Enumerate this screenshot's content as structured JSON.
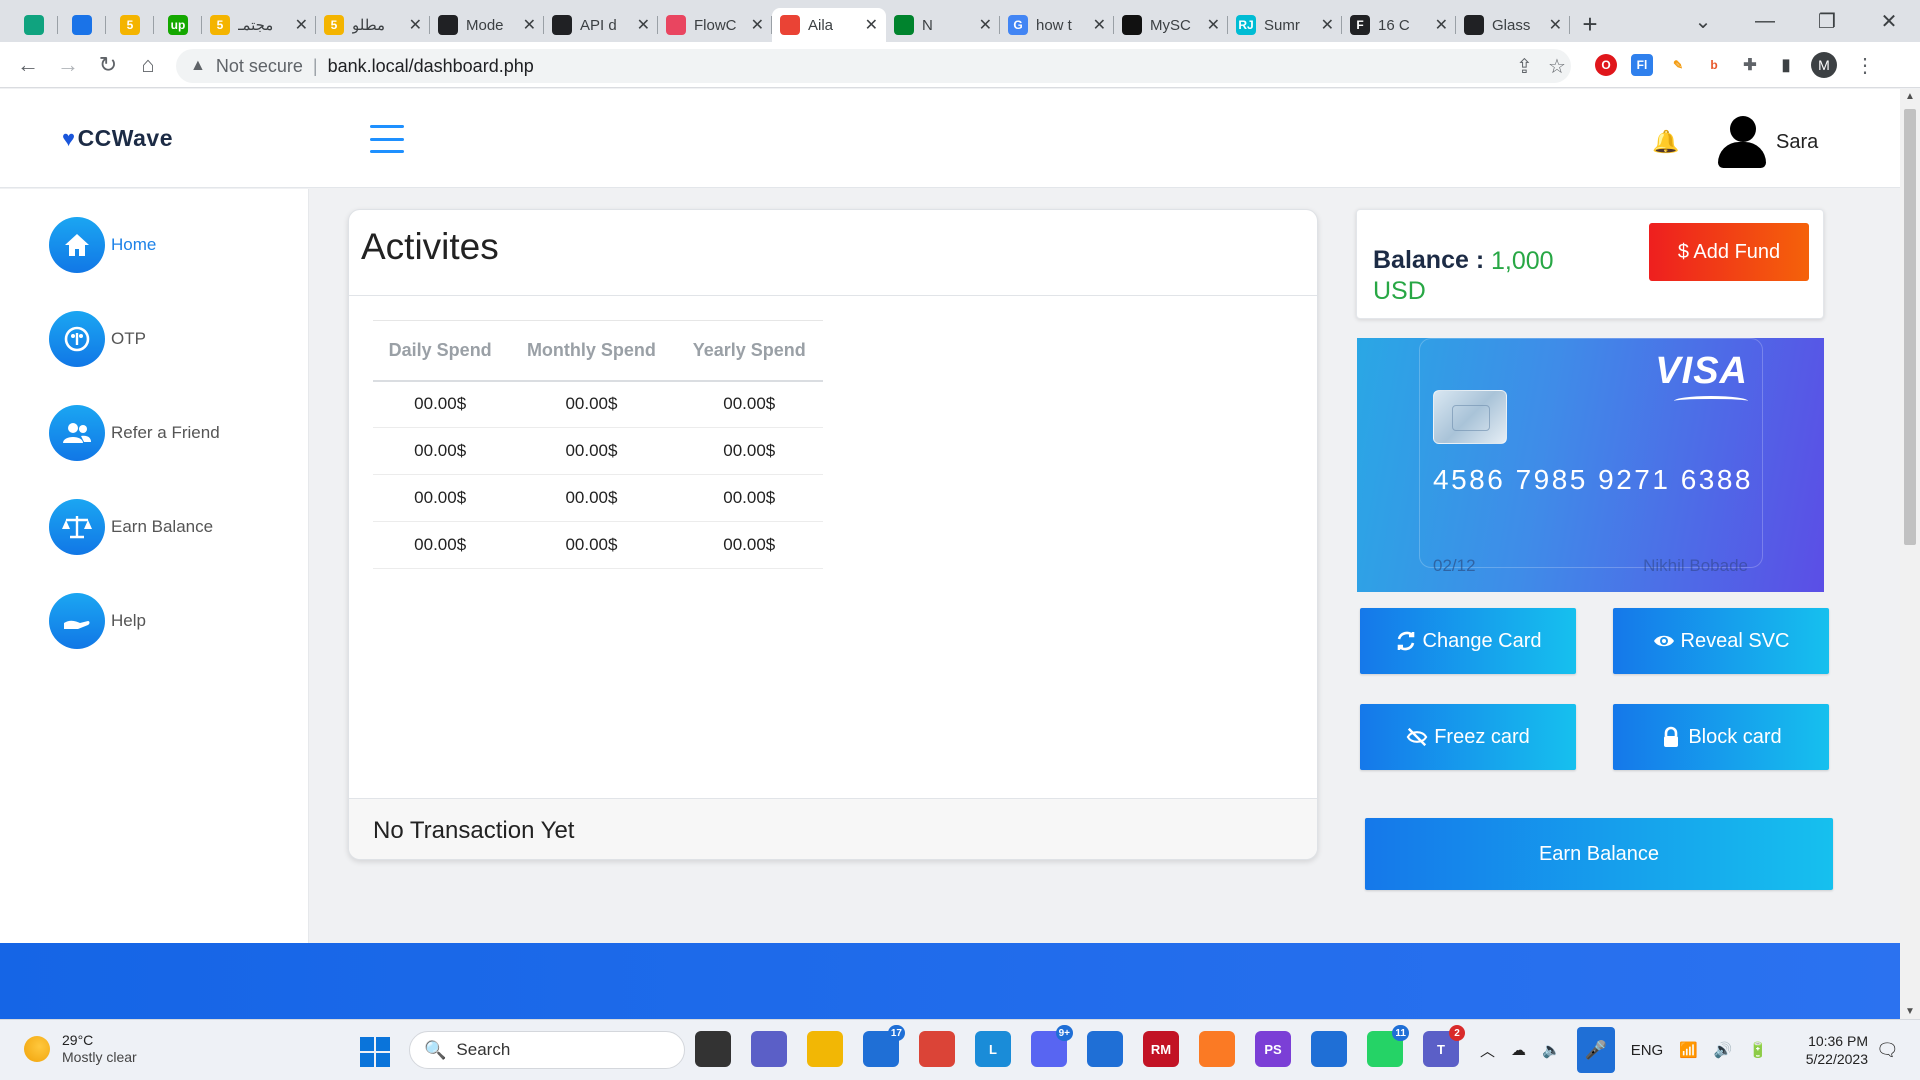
{
  "browser": {
    "tabs": [
      {
        "label": "",
        "icon": "chatgpt-icon",
        "color": "#10a37f",
        "pinned": true
      },
      {
        "label": "",
        "icon": "circle-app-icon",
        "color": "#1a73e8",
        "pinned": true
      },
      {
        "label": "",
        "icon": "five-icon",
        "color": "#f4b400",
        "pinned": true,
        "glyph": "5"
      },
      {
        "label": "",
        "icon": "upwork-icon",
        "color": "#14a800",
        "pinned": true,
        "glyph": "up"
      },
      {
        "label": "مجتمـ",
        "icon": "five-icon",
        "color": "#f4b400",
        "glyph": "5"
      },
      {
        "label": "مطلو",
        "icon": "five-icon",
        "color": "#f4b400",
        "glyph": "5"
      },
      {
        "label": "Mode",
        "icon": "openai-icon",
        "color": "#202124"
      },
      {
        "label": "API d",
        "icon": "openai-icon",
        "color": "#202124"
      },
      {
        "label": "FlowC",
        "icon": "flowcode-icon",
        "color": "#e94560"
      },
      {
        "label": "Aila",
        "icon": "gmail-icon",
        "color": "#ea4335",
        "active": true
      },
      {
        "label": "N",
        "icon": "meet-icon",
        "color": "#00832d"
      },
      {
        "label": "how t",
        "icon": "google-icon",
        "color": "#4285f4",
        "glyph": "G"
      },
      {
        "label": "MySC",
        "icon": "terminal-icon",
        "color": "#111111"
      },
      {
        "label": "Sumr",
        "icon": "rj-icon",
        "color": "#00bcd4",
        "glyph": "RJ"
      },
      {
        "label": "16 C",
        "icon": "f-icon",
        "color": "#202124",
        "glyph": "F"
      },
      {
        "label": "Glass",
        "icon": "openai-icon",
        "color": "#202124"
      }
    ],
    "security_label": "Not secure",
    "url": "bank.local/dashboard.php",
    "profile_initial": "M"
  },
  "site": {
    "brand": "CCWave",
    "user_name": "Sara"
  },
  "sidebar": {
    "items": [
      {
        "label": "Home",
        "icon": "home-icon",
        "active": true
      },
      {
        "label": "OTP",
        "icon": "otp-icon"
      },
      {
        "label": "Refer a Friend",
        "icon": "users-icon"
      },
      {
        "label": "Earn Balance",
        "icon": "scale-icon"
      },
      {
        "label": "Help",
        "icon": "hand-icon"
      }
    ]
  },
  "activities": {
    "title": "Activites",
    "columns": [
      "Daily Spend",
      "Monthly Spend",
      "Yearly Spend"
    ],
    "rows": [
      [
        "00.00$",
        "00.00$",
        "00.00$"
      ],
      [
        "00.00$",
        "00.00$",
        "00.00$"
      ],
      [
        "00.00$",
        "00.00$",
        "00.00$"
      ],
      [
        "00.00$",
        "00.00$",
        "00.00$"
      ]
    ],
    "footer": "No Transaction Yet"
  },
  "balance": {
    "label": "Balance :",
    "amount": "1,000 USD",
    "add_fund_label": "$ Add Fund"
  },
  "card": {
    "brand": "VISA",
    "number": "4586 7985 9271 6388",
    "expiry": "02/12",
    "holder": "Nikhil Bobade"
  },
  "actions": {
    "change_card": "Change Card",
    "reveal_svc": "Reveal SVC",
    "freeze_card": "Freez card",
    "block_card": "Block card",
    "earn_balance": "Earn Balance"
  },
  "taskbar": {
    "weather_temp": "29°C",
    "weather_cond": "Mostly clear",
    "search_label": "Search",
    "apps": [
      {
        "icon": "task-view-icon",
        "color": "#333333"
      },
      {
        "icon": "teams-meet-icon",
        "color": "#5b5fc7"
      },
      {
        "icon": "file-explorer-icon",
        "color": "#f2b705"
      },
      {
        "icon": "store-icon",
        "color": "#1f6fd6",
        "badge": "17"
      },
      {
        "icon": "chrome-icon",
        "color": "#db4437"
      },
      {
        "icon": "l-app-icon",
        "color": "#1a8cd8",
        "glyph": "L"
      },
      {
        "icon": "discord-icon",
        "color": "#5865f2",
        "badge": "9+"
      },
      {
        "icon": "mail-app-icon",
        "color": "#1f6fd6"
      },
      {
        "icon": "rubymine-icon",
        "color": "#c21325",
        "glyph": "RM"
      },
      {
        "icon": "xampp-icon",
        "color": "#fb7a24"
      },
      {
        "icon": "phpstorm-icon",
        "color": "#7b3fd6",
        "glyph": "PS"
      },
      {
        "icon": "notepad-icon",
        "color": "#1f6fd6"
      },
      {
        "icon": "whatsapp-icon",
        "color": "#25d366",
        "badge": "11"
      },
      {
        "icon": "teams-icon",
        "color": "#5b5fc7",
        "glyph": "T",
        "badge": "2",
        "badge_color": "red"
      }
    ],
    "language": "ENG",
    "time": "10:36 PM",
    "date": "5/22/2023"
  }
}
